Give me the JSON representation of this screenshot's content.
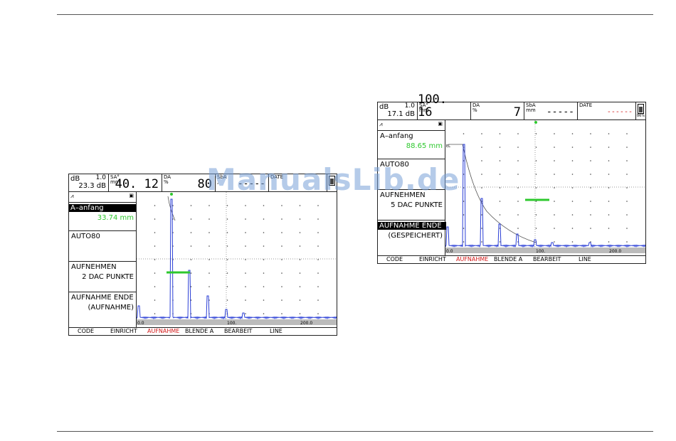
{
  "watermark": "ManualsLib.de",
  "colors": {
    "gate": "#2ec82e",
    "signal": "#2b3fd6",
    "active_tab": "#d21818"
  },
  "screen_left": {
    "header": {
      "db_label": "dB",
      "db_step": "1.0",
      "db_value": "23.3 dB",
      "sa_label": "SA°\nmm",
      "sa_value": "40. 12",
      "da_label": "DA\n%",
      "da_value": "80",
      "sba_label": "SbA\n,",
      "sba_value": "-----",
      "date_label": "DATE"
    },
    "side": {
      "p1_title": "A–anfang",
      "p1_value": "33.74 mm",
      "p2_title": "AUTO80",
      "p3_title": "AUFNEHMEN",
      "p3_value": "2 DAC PUNKTE",
      "p4_title": "AUFNAHME ENDE",
      "p4_value": "(AUFNAHME)"
    },
    "scale": {
      "start": "0.0",
      "mid": "100.",
      "end": "200.0"
    },
    "tabs": [
      "CODE",
      "EINRICHT",
      "AUFNAHME",
      "BLENDE A",
      "BEARBEIT",
      "LINE"
    ]
  },
  "screen_right": {
    "header": {
      "db_label": "dB",
      "db_step": "1.0",
      "db_value": "17.1 dB",
      "sa_label": "SA°\nmm",
      "sa_value": "100. 16",
      "da_label": "DA\n%",
      "da_value": "7",
      "sba_label": "SbA\nmm",
      "sba_value": "-----",
      "date_label": "DATE",
      "date_value": "------",
      "battery": "86%"
    },
    "side": {
      "p1_title": "A–anfang",
      "p1_value": "88.65 mm",
      "p2_title": "AUTO80",
      "p3_title": "AUFNEHMEN",
      "p3_value": "5 DAC PUNKTE",
      "p4_title": "AUFNAHME ENDE",
      "p4_value": "(GESPEICHERT)"
    },
    "scale": {
      "start": "0.0",
      "mid": "100.",
      "end": "200.0",
      "el": "EL"
    },
    "tabs": [
      "CODE",
      "EINRICHT",
      "AUFNAHME",
      "BLENDE A",
      "BEARBEIT",
      "LINE"
    ]
  }
}
